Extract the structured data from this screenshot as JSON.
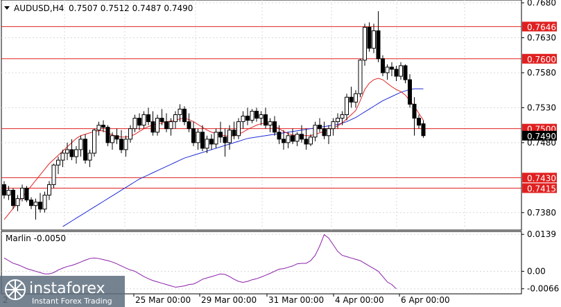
{
  "chart_data": [
    {
      "type": "candlestick",
      "symbol_header": "AUDUSD,H4",
      "ohlc_header": "0.7507 0.7512 0.7487 0.7490",
      "ylim": [
        0.7355,
        0.7684
      ],
      "y_ticks": [
        "0.7680",
        "0.7630",
        "0.7580",
        "0.7530",
        "0.7480",
        "0.7380"
      ],
      "x_tick_labels": [
        "25 Mar 00:00",
        "29 Mar 00:00",
        "31 Mar 00:00",
        "4 Apr 00:00",
        "6 Apr 00:00"
      ],
      "partial_first_label": "2",
      "grid": true,
      "current_price": "0.7490",
      "levels": [
        {
          "value": 0.7646,
          "label": "0.7646"
        },
        {
          "value": 0.76,
          "label": "0.7600"
        },
        {
          "value": 0.75,
          "label": "0.7500"
        },
        {
          "value": 0.743,
          "label": "0.7430"
        },
        {
          "value": 0.7415,
          "label": "0.7415"
        }
      ],
      "candles": [
        [
          0.742,
          0.7425,
          0.74,
          0.7405
        ],
        [
          0.7405,
          0.7418,
          0.7398,
          0.7412
        ],
        [
          0.7412,
          0.7415,
          0.7385,
          0.739
        ],
        [
          0.739,
          0.7405,
          0.7382,
          0.74
        ],
        [
          0.74,
          0.742,
          0.7396,
          0.7415
        ],
        [
          0.7415,
          0.7418,
          0.7395,
          0.7398
        ],
        [
          0.7398,
          0.7402,
          0.7385,
          0.739
        ],
        [
          0.739,
          0.74,
          0.737,
          0.7395
        ],
        [
          0.7395,
          0.7408,
          0.738,
          0.7385
        ],
        [
          0.7385,
          0.741,
          0.738,
          0.7405
        ],
        [
          0.7405,
          0.7425,
          0.7398,
          0.742
        ],
        [
          0.742,
          0.745,
          0.7415,
          0.7448
        ],
        [
          0.7448,
          0.746,
          0.7435,
          0.7455
        ],
        [
          0.7455,
          0.747,
          0.7445,
          0.7465
        ],
        [
          0.7465,
          0.748,
          0.7455,
          0.747
        ],
        [
          0.747,
          0.7485,
          0.7455,
          0.746
        ],
        [
          0.746,
          0.7475,
          0.745,
          0.747
        ],
        [
          0.747,
          0.749,
          0.746,
          0.7485
        ],
        [
          0.7485,
          0.7492,
          0.745,
          0.7455
        ],
        [
          0.7455,
          0.747,
          0.7445,
          0.7465
        ],
        [
          0.7465,
          0.75,
          0.746,
          0.7498
        ],
        [
          0.7498,
          0.751,
          0.749,
          0.7505
        ],
        [
          0.7505,
          0.7512,
          0.7495,
          0.7502
        ],
        [
          0.7502,
          0.7505,
          0.7475,
          0.748
        ],
        [
          0.748,
          0.7495,
          0.747,
          0.749
        ],
        [
          0.749,
          0.75,
          0.7478,
          0.7485
        ],
        [
          0.7485,
          0.7498,
          0.7465,
          0.747
        ],
        [
          0.747,
          0.749,
          0.746,
          0.7485
        ],
        [
          0.7485,
          0.7505,
          0.748,
          0.75
        ],
        [
          0.75,
          0.752,
          0.7495,
          0.7515
        ],
        [
          0.7515,
          0.7522,
          0.7498,
          0.7505
        ],
        [
          0.7505,
          0.7525,
          0.75,
          0.752
        ],
        [
          0.752,
          0.753,
          0.7505,
          0.751
        ],
        [
          0.751,
          0.7525,
          0.749,
          0.7495
        ],
        [
          0.7495,
          0.752,
          0.749,
          0.7515
        ],
        [
          0.7515,
          0.7528,
          0.7505,
          0.751
        ],
        [
          0.751,
          0.7522,
          0.7495,
          0.75
        ],
        [
          0.75,
          0.7515,
          0.749,
          0.751
        ],
        [
          0.751,
          0.7525,
          0.75,
          0.752
        ],
        [
          0.752,
          0.7535,
          0.751,
          0.7528
        ],
        [
          0.7528,
          0.7532,
          0.7505,
          0.751
        ],
        [
          0.751,
          0.7522,
          0.7495,
          0.75
        ],
        [
          0.75,
          0.751,
          0.7475,
          0.748
        ],
        [
          0.748,
          0.75,
          0.747,
          0.7495
        ],
        [
          0.7495,
          0.7505,
          0.7468,
          0.7472
        ],
        [
          0.7472,
          0.749,
          0.7465,
          0.7485
        ],
        [
          0.7485,
          0.7492,
          0.747,
          0.7478
        ],
        [
          0.7478,
          0.75,
          0.7472,
          0.7495
        ],
        [
          0.7495,
          0.751,
          0.748,
          0.7488
        ],
        [
          0.7488,
          0.75,
          0.746,
          0.748
        ],
        [
          0.748,
          0.7505,
          0.747,
          0.7498
        ],
        [
          0.7498,
          0.751,
          0.7485,
          0.749
        ],
        [
          0.749,
          0.7515,
          0.7485,
          0.751
        ],
        [
          0.751,
          0.7525,
          0.75,
          0.7518
        ],
        [
          0.7518,
          0.753,
          0.7505,
          0.7512
        ],
        [
          0.7512,
          0.7528,
          0.7508,
          0.7525
        ],
        [
          0.7525,
          0.753,
          0.751,
          0.7515
        ],
        [
          0.7515,
          0.7525,
          0.7505,
          0.752
        ],
        [
          0.752,
          0.753,
          0.75,
          0.7505
        ],
        [
          0.7505,
          0.7515,
          0.7495,
          0.751
        ],
        [
          0.751,
          0.7518,
          0.749,
          0.7495
        ],
        [
          0.7495,
          0.7505,
          0.7478,
          0.7485
        ],
        [
          0.7485,
          0.7498,
          0.747,
          0.748
        ],
        [
          0.748,
          0.7495,
          0.7472,
          0.749
        ],
        [
          0.749,
          0.75,
          0.7478,
          0.7482
        ],
        [
          0.7482,
          0.7495,
          0.7475,
          0.7492
        ],
        [
          0.7492,
          0.7505,
          0.748,
          0.7485
        ],
        [
          0.7485,
          0.75,
          0.747,
          0.7478
        ],
        [
          0.7478,
          0.7492,
          0.7475,
          0.7488
        ],
        [
          0.7488,
          0.751,
          0.7482,
          0.7505
        ],
        [
          0.7505,
          0.7515,
          0.7495,
          0.75
        ],
        [
          0.75,
          0.751,
          0.7485,
          0.749
        ],
        [
          0.749,
          0.7505,
          0.7478,
          0.75
        ],
        [
          0.75,
          0.7515,
          0.749,
          0.751
        ],
        [
          0.751,
          0.7522,
          0.75,
          0.7515
        ],
        [
          0.7515,
          0.7525,
          0.7505,
          0.752
        ],
        [
          0.752,
          0.755,
          0.7512,
          0.7545
        ],
        [
          0.7545,
          0.756,
          0.753,
          0.7538
        ],
        [
          0.7538,
          0.7555,
          0.753,
          0.755
        ],
        [
          0.755,
          0.76,
          0.7545,
          0.7598
        ],
        [
          0.7598,
          0.765,
          0.759,
          0.7645
        ],
        [
          0.7645,
          0.7652,
          0.761,
          0.7615
        ],
        [
          0.7615,
          0.765,
          0.7608,
          0.764
        ],
        [
          0.764,
          0.7668,
          0.7595,
          0.76
        ],
        [
          0.76,
          0.7605,
          0.7575,
          0.758
        ],
        [
          0.758,
          0.7592,
          0.757,
          0.7588
        ],
        [
          0.7588,
          0.7595,
          0.7575,
          0.7585
        ],
        [
          0.7585,
          0.759,
          0.7568,
          0.7575
        ],
        [
          0.7575,
          0.7595,
          0.757,
          0.759
        ],
        [
          0.759,
          0.7592,
          0.7565,
          0.757
        ],
        [
          0.757,
          0.7578,
          0.753,
          0.7535
        ],
        [
          0.7535,
          0.7545,
          0.749,
          0.7515
        ],
        [
          0.7515,
          0.752,
          0.75,
          0.7505
        ],
        [
          0.7507,
          0.7512,
          0.7487,
          0.749
        ]
      ],
      "ma_fast": [
        0.737,
        0.7378,
        0.7386,
        0.7394,
        0.7402,
        0.741,
        0.7418,
        0.7426,
        0.7434,
        0.7442,
        0.745,
        0.7456,
        0.7462,
        0.7468,
        0.7474,
        0.748,
        0.7486,
        0.749,
        0.7492,
        0.7494,
        0.7496,
        0.7497,
        0.7497,
        0.7494,
        0.7491,
        0.7489,
        0.7488,
        0.7488,
        0.7489,
        0.7492,
        0.7496,
        0.75,
        0.7503,
        0.7505,
        0.7507,
        0.7508,
        0.751,
        0.7511,
        0.7512,
        0.7514,
        0.7515,
        0.7513,
        0.751,
        0.7506,
        0.7502,
        0.7498,
        0.7495,
        0.7493,
        0.7491,
        0.749,
        0.7489,
        0.749,
        0.7492,
        0.7495,
        0.7499,
        0.7502,
        0.7505,
        0.7507,
        0.7508,
        0.7507,
        0.7504,
        0.75,
        0.7496,
        0.7493,
        0.7491,
        0.749,
        0.749,
        0.749,
        0.749,
        0.7492,
        0.7494,
        0.7496,
        0.7498,
        0.7501,
        0.7504,
        0.7508,
        0.7514,
        0.752,
        0.7526,
        0.754,
        0.7556,
        0.7565,
        0.757,
        0.7572,
        0.757,
        0.7565,
        0.756,
        0.7556,
        0.7553,
        0.7548,
        0.754,
        0.7532,
        0.7522,
        0.7512
      ],
      "ma_slow": [
        null,
        null,
        null,
        null,
        null,
        null,
        null,
        null,
        null,
        null,
        null,
        null,
        null,
        0.736,
        0.7364,
        0.7368,
        0.7372,
        0.7376,
        0.738,
        0.7384,
        0.7388,
        0.7392,
        0.7396,
        0.74,
        0.7404,
        0.7408,
        0.7412,
        0.7416,
        0.742,
        0.7424,
        0.7428,
        0.7431,
        0.7434,
        0.7437,
        0.744,
        0.7443,
        0.7446,
        0.7449,
        0.7452,
        0.7455,
        0.7458,
        0.746,
        0.7462,
        0.7464,
        0.7466,
        0.7468,
        0.747,
        0.7472,
        0.7474,
        0.7476,
        0.7478,
        0.748,
        0.7482,
        0.7484,
        0.7486,
        0.7487,
        0.7488,
        0.7489,
        0.749,
        0.7491,
        0.7492,
        0.7493,
        0.7494,
        0.7495,
        0.7496,
        0.7497,
        0.7498,
        0.7499,
        0.75,
        0.7501,
        0.7502,
        0.7503,
        0.7504,
        0.7505,
        0.7506,
        0.7508,
        0.751,
        0.7513,
        0.7516,
        0.752,
        0.7524,
        0.7528,
        0.7532,
        0.7536,
        0.754,
        0.7543,
        0.7546,
        0.7549,
        0.7552,
        0.7554,
        0.7556,
        0.7557,
        0.7557,
        0.7557
      ]
    },
    {
      "type": "line",
      "label": "Marlin -0.0050",
      "ylim": [
        -0.0085,
        0.015
      ],
      "y_ticks": [
        "0.0139",
        "0.00",
        "-0.0066"
      ],
      "values": [
        0.005,
        0.004,
        0.003,
        0.0025,
        0.0018,
        0.001,
        0.0005,
        0.0,
        -0.0005,
        -0.001,
        -0.001,
        -0.0005,
        0.0005,
        0.0012,
        0.0018,
        0.0022,
        0.0028,
        0.0035,
        0.0042,
        0.0048,
        0.005,
        0.0048,
        0.0044,
        0.004,
        0.0035,
        0.0028,
        0.002,
        0.0012,
        0.0005,
        0.0,
        -0.001,
        -0.002,
        -0.0028,
        -0.0035,
        -0.004,
        -0.0045,
        -0.005,
        -0.0055,
        -0.006,
        -0.0058,
        -0.0055,
        -0.005,
        -0.0048,
        -0.004,
        -0.003,
        -0.0025,
        -0.002,
        -0.0015,
        -0.001,
        -0.0012,
        -0.002,
        -0.003,
        -0.0038,
        -0.0042,
        -0.0038,
        -0.0032,
        -0.0028,
        -0.0022,
        -0.0015,
        -0.0008,
        0.0,
        0.0008,
        0.001,
        0.0015,
        0.002,
        0.0028,
        0.003,
        0.003,
        0.004,
        0.006,
        0.0095,
        0.0138,
        0.0125,
        0.01,
        0.0075,
        0.006,
        0.0055,
        0.005,
        0.0045,
        0.004,
        0.003,
        0.002,
        0.001,
        0.0,
        -0.002,
        -0.004,
        -0.005,
        -0.0066
      ]
    }
  ],
  "logo": {
    "brand": "instaforex",
    "tagline": "Instant Forex Trading"
  },
  "colors": {
    "candle_up": "#ffffff",
    "candle_down": "#000000",
    "ma_fast": "#e02424",
    "ma_slow": "#1e2bd6",
    "level_line": "#e02020",
    "marlin": "#8a1fa8",
    "grid": "#d8d8d8",
    "badge_bg": "#e02020",
    "price_badge_bg": "#000000"
  }
}
